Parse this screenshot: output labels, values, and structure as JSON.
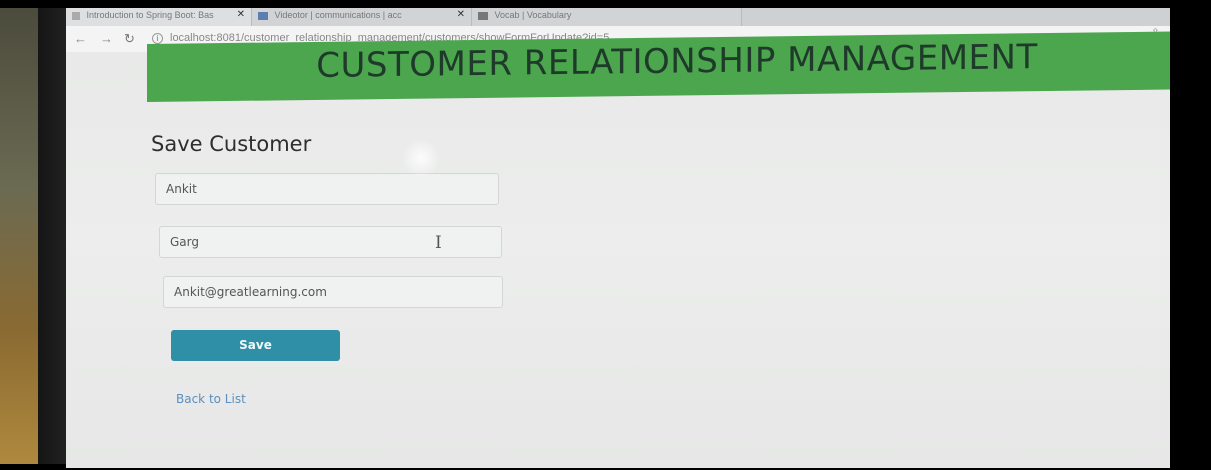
{
  "browser": {
    "tabs": [
      {
        "label": "Introduction to Spring Boot: Bas"
      },
      {
        "label": "Videotor | communications | acc"
      },
      {
        "label": "Vocab | Vocabulary"
      }
    ],
    "url": "localhost:8081/customer_relationship_management/customers/showFormForUpdate?id=5"
  },
  "header": {
    "title": "CUSTOMER RELATIONSHIP MANAGEMENT"
  },
  "form": {
    "heading": "Save Customer",
    "first_name": "Ankit",
    "last_name": "Garg",
    "email": "Ankit@greatlearning.com",
    "save_label": "Save"
  },
  "links": {
    "back_to_list": "Back to List"
  },
  "colors": {
    "banner": "#4ba64e",
    "save_button": "#2f8fa6",
    "link": "#5c8fbf"
  }
}
